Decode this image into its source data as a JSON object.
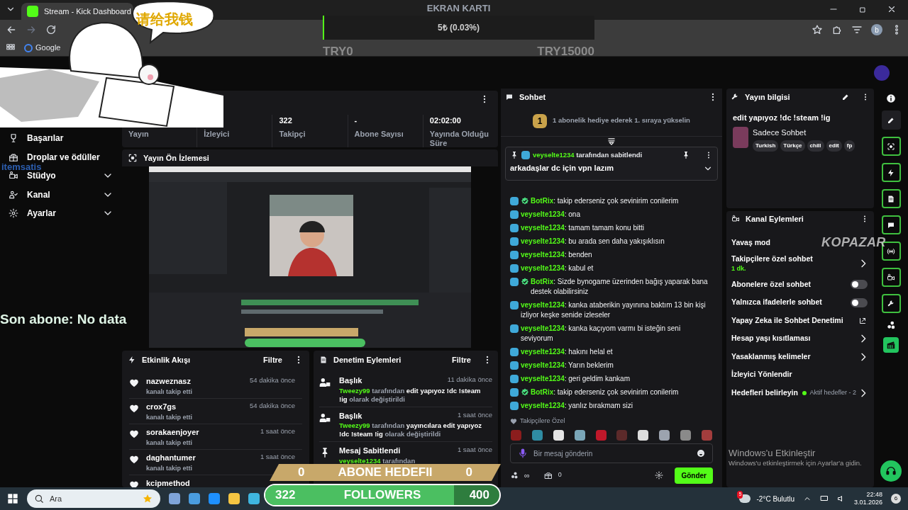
{
  "browser": {
    "tab_title": "Stream - Kick Dashboard",
    "bookmark": "Google",
    "profile_initial": "b"
  },
  "top_goal": {
    "title": "EKRAN KARTI",
    "amount": "5₺ (0.03%)",
    "level": 0.0003,
    "min": "TRY0",
    "max": "TRY15000"
  },
  "sticker": {
    "speech": "请给我钱"
  },
  "overlay_logo": "itemsatis",
  "last_subscriber": "Son abone: No data",
  "sidebar": {
    "items": [
      {
        "label": "Başarılar",
        "expandable": false
      },
      {
        "label": "Droplar ve ödüller",
        "expandable": false
      },
      {
        "label": "Stüdyo",
        "expandable": true
      },
      {
        "label": "Kanal",
        "expandable": true
      },
      {
        "label": "Ayarlar",
        "expandable": true
      }
    ]
  },
  "stats": [
    {
      "label": "Yayın"
    },
    {
      "label": "İzleyici"
    },
    {
      "value": "322",
      "label": "Takipçi"
    },
    {
      "value": "-",
      "label": "Abone Sayısı"
    },
    {
      "value": "02:02:00",
      "label": "Yayında Olduğu Süre"
    }
  ],
  "preview": {
    "title": "Yayın Ön İzlemesi",
    "kind": "picture"
  },
  "events": {
    "title": "Etkinlik Akışı",
    "filter": "Filtre",
    "items": [
      {
        "user": "nazweznasz",
        "action": "kanalı takip etti",
        "time": "54 dakika önce"
      },
      {
        "user": "crox7gs",
        "action": "kanalı takip etti",
        "time": "54 dakika önce"
      },
      {
        "user": "sorakaenjoyer",
        "action": "kanalı takip etti",
        "time": "1 saat önce"
      },
      {
        "user": "daghantumer",
        "action": "kanalı takip etti",
        "time": "1 saat önce"
      },
      {
        "user": "kcipmethod"
      }
    ]
  },
  "moderation": {
    "title": "Denetim Eylemleri",
    "filter": "Filtre",
    "items": [
      {
        "kind": "title",
        "title": "Başlık",
        "time": "11 dakika önce",
        "user": "Tweezy99",
        "text": "tarafından **edit yapıyoz !dc !steam !ig** olarak değiştirildi"
      },
      {
        "kind": "title",
        "title": "Başlık",
        "time": "1 saat önce",
        "user": "Tweezy99",
        "text": "tarafından **yayıncılara edit yapıyoz !dc !steam !ig** olarak değiştirildi"
      },
      {
        "kind": "pin",
        "title": "Mesaj Sabitlendi",
        "time": "1 saat önce",
        "user": "veyselte1234",
        "text": "tarafından"
      }
    ]
  },
  "chat": {
    "title": "Sohbet",
    "promo_rank": "1",
    "promo": "1 abonelik hediye ederek 1. sıraya yükselin",
    "pinned": {
      "user": "veyselte1234",
      "by": "tarafından sabitlendi",
      "message": "arkadaşlar dc için vpn lazım"
    },
    "messages": [
      {
        "user": "BotRix",
        "verified": true,
        "text": ": takip ederseniz çok sevinirim conilerim"
      },
      {
        "user": "veyselte1234",
        "verified": false,
        "text": ": ona"
      },
      {
        "user": "veyselte1234",
        "verified": false,
        "text": ": tamam tamam konu bitti"
      },
      {
        "user": "veyselte1234",
        "verified": false,
        "text": ": bu arada sen daha yakışıklısın"
      },
      {
        "user": "veyselte1234",
        "verified": false,
        "text": ": benden"
      },
      {
        "user": "veyselte1234",
        "verified": false,
        "text": ": kabul et"
      },
      {
        "user": "BotRix",
        "verified": true,
        "text": ": Sizde bynogame üzerinden bağış yaparak bana destek olabilirsiniz"
      },
      {
        "user": "veyselte1234",
        "verified": false,
        "text": ": kanka ataberikin yayınına baktım 13 bin kişi izliyor keşke senide izleseler"
      },
      {
        "user": "veyselte1234",
        "verified": false,
        "text": ": kanka kaçıyom varmı bi isteğin seni seviyorum"
      },
      {
        "user": "veyselte1234",
        "verified": false,
        "text": ": hakını helal et"
      },
      {
        "user": "veyselte1234",
        "verified": false,
        "text": ": Yarın beklerim"
      },
      {
        "user": "veyselte1234",
        "verified": false,
        "text": ": geri geldim kankam"
      },
      {
        "user": "BotRix",
        "verified": true,
        "text": ": takip ederseniz çok sevinirim conilerim"
      },
      {
        "user": "veyselte1234",
        "verified": false,
        "text": ": yanlız bırakmam sizi"
      }
    ],
    "emote_section": "Takipçilere Özel",
    "input_placeholder": "Bir mesaj gönderin",
    "points": "∞",
    "gifts": "0",
    "send": "Gönder"
  },
  "stream_info": {
    "title": "Yayın bilgisi",
    "stream_title": "edit yapıyoz !dc !steam !ig",
    "category": "Sadece Sohbet",
    "tags": [
      "Turkish",
      "Türkçe",
      "chill",
      "edit",
      "fp"
    ]
  },
  "channel_actions": {
    "title": "Kanal Eylemleri",
    "items": [
      {
        "kind": "plain",
        "label": "Yavaş mod"
      },
      {
        "kind": "chevron",
        "label": "Takipçilere özel sohbet",
        "sub": "1 dk."
      },
      {
        "kind": "toggle",
        "label": "Abonelere özel sohbet",
        "on": false
      },
      {
        "kind": "toggle",
        "label": "Yalnızca ifadelerle sohbet",
        "on": false
      },
      {
        "kind": "external",
        "label": "Yapay Zeka ile Sohbet Denetimi"
      },
      {
        "kind": "chevron",
        "label": "Hesap yaşı kısıtlaması"
      },
      {
        "kind": "chevron",
        "label": "Yasaklanmış kelimeler"
      },
      {
        "kind": "plain",
        "label": "İzleyici Yönlendir"
      },
      {
        "kind": "chevron",
        "label": "Hedefleri belirleyin",
        "status": "Aktif hedefler - 2",
        "color": "#53fc18"
      }
    ]
  },
  "overlay_brand": "KOPAZAR",
  "activation": {
    "title": "Windows'u Etkinleştir",
    "text": "Windows'u etkinleştirmek için Ayarlar'a gidin."
  },
  "goals": [
    {
      "kind": "subs",
      "current": "0",
      "title": "ABONE HEDEFII",
      "target": "0"
    },
    {
      "kind": "followers",
      "current": "322",
      "title": "FOLLOWERS",
      "target": "400",
      "level": 0.805
    }
  ],
  "taskbar": {
    "search": "Ara",
    "weather": "-2°C Bulutlu",
    "weather_badge": "5",
    "time": "22:48",
    "date": "3.01.2026",
    "notifications": "6"
  }
}
